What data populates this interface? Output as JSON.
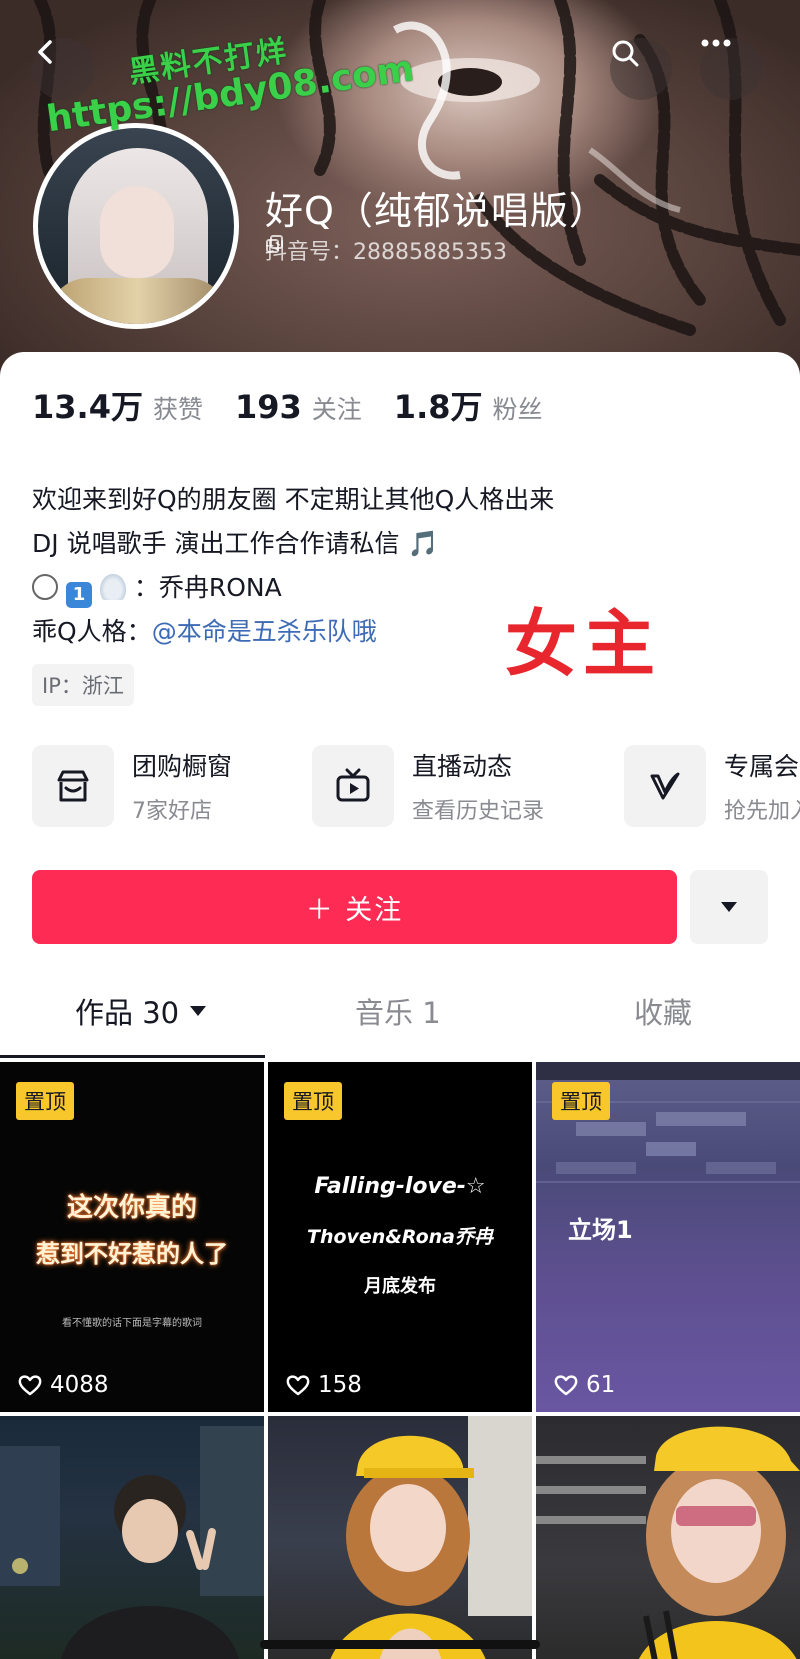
{
  "header": {
    "watermark_line1": "黑料不打烊",
    "watermark_line2": "https://bdy08.com",
    "nickname": "好Q（纯郁说唱版）",
    "douyin_id": "抖音号：28885885353"
  },
  "stats": [
    {
      "value": "13.4万",
      "label": "获赞"
    },
    {
      "value": "193",
      "label": "关注"
    },
    {
      "value": "1.8万",
      "label": "粉丝"
    }
  ],
  "bio": {
    "line1": "欢迎来到好Q的朋友圈 不定期让其他Q人格出来",
    "line2": " DJ 说唱歌手 演出工作合作请私信 🎵",
    "line3_text": "：乔冉RONA",
    "line4_prefix": "乖Q人格：",
    "line4_mention": "@本命是五杀乐队哦"
  },
  "overlay_tag": "女主",
  "ip": "IP：浙江",
  "shortcuts": [
    {
      "title": "团购橱窗",
      "subtitle": "7家好店",
      "icon": "store-icon"
    },
    {
      "title": "直播动态",
      "subtitle": "查看历史记录",
      "icon": "tv-icon"
    },
    {
      "title": "专属会",
      "subtitle": "抢先加入",
      "icon": "vip-v-icon"
    }
  ],
  "follow_label": "＋ 关注",
  "tabs": [
    {
      "label": "作品 30"
    },
    {
      "label": "音乐 1"
    },
    {
      "label": "收藏"
    }
  ],
  "grid": [
    {
      "pinned": "置顶",
      "likes": "4088",
      "caption1": "这次你真的",
      "caption2": "惹到不好惹的人了",
      "caption3": "看不懂歌的话下面是字幕的歌词"
    },
    {
      "pinned": "置顶",
      "likes": "158",
      "caption1": "Falling-love-☆",
      "caption2": "Thoven&Rona乔冉",
      "caption3": "月底发布"
    },
    {
      "pinned": "置顶",
      "likes": "61",
      "caption1": "立场1"
    },
    {},
    {},
    {}
  ],
  "colors": {
    "accent_red": "#fe2c55",
    "mention_blue": "#3d6bb6",
    "pin_yellow": "#f7c72b",
    "overlay_red": "#e8262e",
    "watermark_green": "#3ad04a"
  }
}
